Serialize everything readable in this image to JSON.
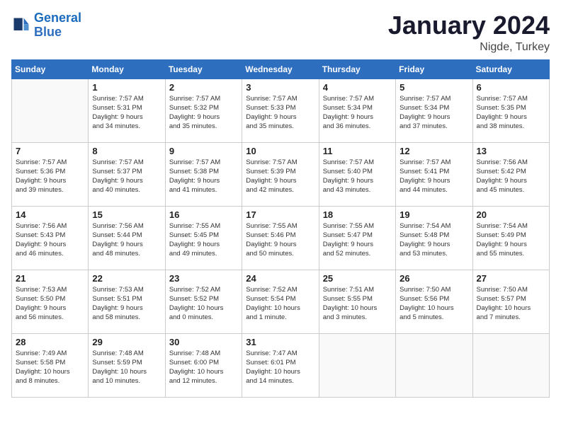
{
  "header": {
    "logo_text1": "General",
    "logo_text2": "Blue",
    "month": "January 2024",
    "location": "Nigde, Turkey"
  },
  "weekdays": [
    "Sunday",
    "Monday",
    "Tuesday",
    "Wednesday",
    "Thursday",
    "Friday",
    "Saturday"
  ],
  "weeks": [
    [
      {
        "day": "",
        "info": ""
      },
      {
        "day": "1",
        "info": "Sunrise: 7:57 AM\nSunset: 5:31 PM\nDaylight: 9 hours\nand 34 minutes."
      },
      {
        "day": "2",
        "info": "Sunrise: 7:57 AM\nSunset: 5:32 PM\nDaylight: 9 hours\nand 35 minutes."
      },
      {
        "day": "3",
        "info": "Sunrise: 7:57 AM\nSunset: 5:33 PM\nDaylight: 9 hours\nand 35 minutes."
      },
      {
        "day": "4",
        "info": "Sunrise: 7:57 AM\nSunset: 5:34 PM\nDaylight: 9 hours\nand 36 minutes."
      },
      {
        "day": "5",
        "info": "Sunrise: 7:57 AM\nSunset: 5:34 PM\nDaylight: 9 hours\nand 37 minutes."
      },
      {
        "day": "6",
        "info": "Sunrise: 7:57 AM\nSunset: 5:35 PM\nDaylight: 9 hours\nand 38 minutes."
      }
    ],
    [
      {
        "day": "7",
        "info": "Sunrise: 7:57 AM\nSunset: 5:36 PM\nDaylight: 9 hours\nand 39 minutes."
      },
      {
        "day": "8",
        "info": "Sunrise: 7:57 AM\nSunset: 5:37 PM\nDaylight: 9 hours\nand 40 minutes."
      },
      {
        "day": "9",
        "info": "Sunrise: 7:57 AM\nSunset: 5:38 PM\nDaylight: 9 hours\nand 41 minutes."
      },
      {
        "day": "10",
        "info": "Sunrise: 7:57 AM\nSunset: 5:39 PM\nDaylight: 9 hours\nand 42 minutes."
      },
      {
        "day": "11",
        "info": "Sunrise: 7:57 AM\nSunset: 5:40 PM\nDaylight: 9 hours\nand 43 minutes."
      },
      {
        "day": "12",
        "info": "Sunrise: 7:57 AM\nSunset: 5:41 PM\nDaylight: 9 hours\nand 44 minutes."
      },
      {
        "day": "13",
        "info": "Sunrise: 7:56 AM\nSunset: 5:42 PM\nDaylight: 9 hours\nand 45 minutes."
      }
    ],
    [
      {
        "day": "14",
        "info": "Sunrise: 7:56 AM\nSunset: 5:43 PM\nDaylight: 9 hours\nand 46 minutes."
      },
      {
        "day": "15",
        "info": "Sunrise: 7:56 AM\nSunset: 5:44 PM\nDaylight: 9 hours\nand 48 minutes."
      },
      {
        "day": "16",
        "info": "Sunrise: 7:55 AM\nSunset: 5:45 PM\nDaylight: 9 hours\nand 49 minutes."
      },
      {
        "day": "17",
        "info": "Sunrise: 7:55 AM\nSunset: 5:46 PM\nDaylight: 9 hours\nand 50 minutes."
      },
      {
        "day": "18",
        "info": "Sunrise: 7:55 AM\nSunset: 5:47 PM\nDaylight: 9 hours\nand 52 minutes."
      },
      {
        "day": "19",
        "info": "Sunrise: 7:54 AM\nSunset: 5:48 PM\nDaylight: 9 hours\nand 53 minutes."
      },
      {
        "day": "20",
        "info": "Sunrise: 7:54 AM\nSunset: 5:49 PM\nDaylight: 9 hours\nand 55 minutes."
      }
    ],
    [
      {
        "day": "21",
        "info": "Sunrise: 7:53 AM\nSunset: 5:50 PM\nDaylight: 9 hours\nand 56 minutes."
      },
      {
        "day": "22",
        "info": "Sunrise: 7:53 AM\nSunset: 5:51 PM\nDaylight: 9 hours\nand 58 minutes."
      },
      {
        "day": "23",
        "info": "Sunrise: 7:52 AM\nSunset: 5:52 PM\nDaylight: 10 hours\nand 0 minutes."
      },
      {
        "day": "24",
        "info": "Sunrise: 7:52 AM\nSunset: 5:54 PM\nDaylight: 10 hours\nand 1 minute."
      },
      {
        "day": "25",
        "info": "Sunrise: 7:51 AM\nSunset: 5:55 PM\nDaylight: 10 hours\nand 3 minutes."
      },
      {
        "day": "26",
        "info": "Sunrise: 7:50 AM\nSunset: 5:56 PM\nDaylight: 10 hours\nand 5 minutes."
      },
      {
        "day": "27",
        "info": "Sunrise: 7:50 AM\nSunset: 5:57 PM\nDaylight: 10 hours\nand 7 minutes."
      }
    ],
    [
      {
        "day": "28",
        "info": "Sunrise: 7:49 AM\nSunset: 5:58 PM\nDaylight: 10 hours\nand 8 minutes."
      },
      {
        "day": "29",
        "info": "Sunrise: 7:48 AM\nSunset: 5:59 PM\nDaylight: 10 hours\nand 10 minutes."
      },
      {
        "day": "30",
        "info": "Sunrise: 7:48 AM\nSunset: 6:00 PM\nDaylight: 10 hours\nand 12 minutes."
      },
      {
        "day": "31",
        "info": "Sunrise: 7:47 AM\nSunset: 6:01 PM\nDaylight: 10 hours\nand 14 minutes."
      },
      {
        "day": "",
        "info": ""
      },
      {
        "day": "",
        "info": ""
      },
      {
        "day": "",
        "info": ""
      }
    ]
  ]
}
